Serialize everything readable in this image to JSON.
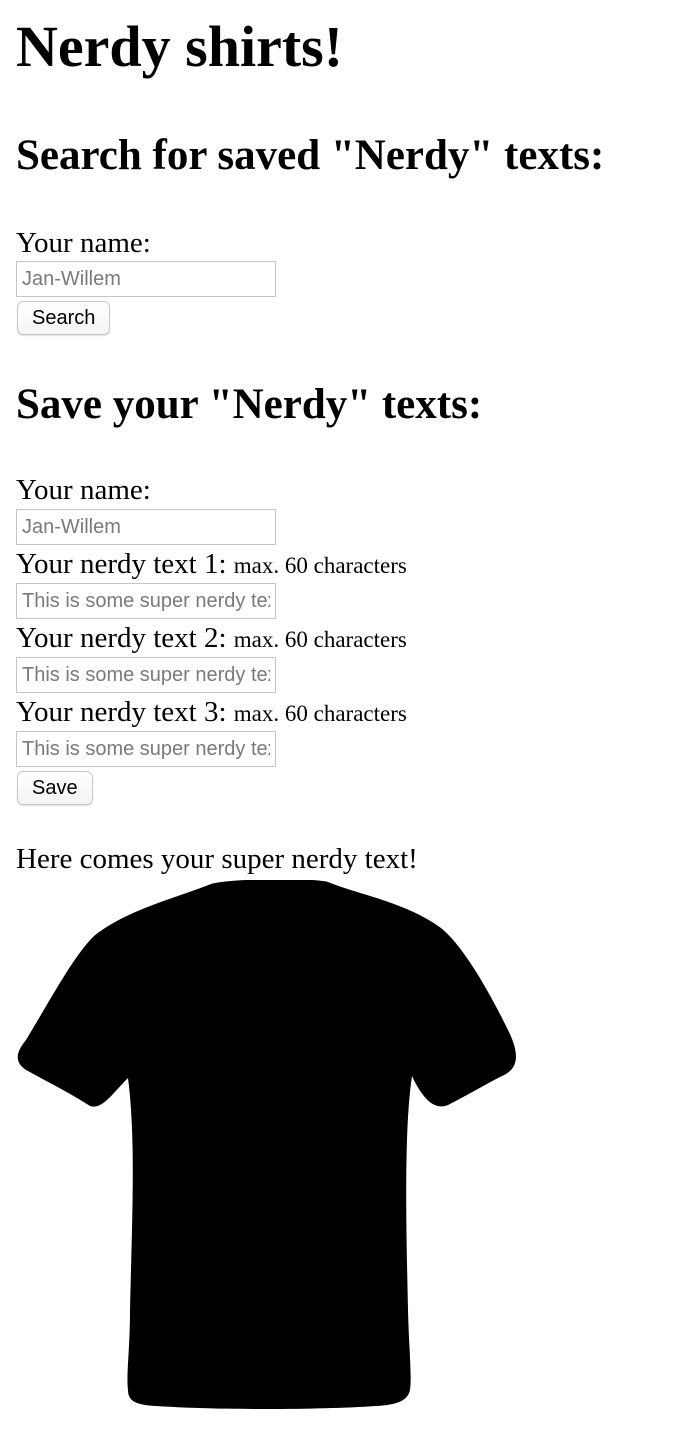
{
  "page": {
    "title": "Nerdy shirts!"
  },
  "search": {
    "heading": "Search for saved \"Nerdy\" texts:",
    "name_label": "Your name:",
    "name_placeholder": "Jan-Willem",
    "button_label": "Search"
  },
  "save": {
    "heading": "Save your \"Nerdy\" texts:",
    "name_label": "Your name:",
    "name_placeholder": "Jan-Willem",
    "texts": [
      {
        "label": "Your nerdy text 1:",
        "hint": "max. 60 characters",
        "placeholder": "This is some super nerdy text"
      },
      {
        "label": "Your nerdy text 2:",
        "hint": "max. 60 characters",
        "placeholder": "This is some super nerdy text"
      },
      {
        "label": "Your nerdy text 3:",
        "hint": "max. 60 characters",
        "placeholder": "This is some super nerdy text"
      }
    ],
    "button_label": "Save"
  },
  "preview": {
    "caption": "Here comes your super nerdy text!",
    "shirt_color": "#000000",
    "shirt_icon": "t-shirt-icon"
  }
}
